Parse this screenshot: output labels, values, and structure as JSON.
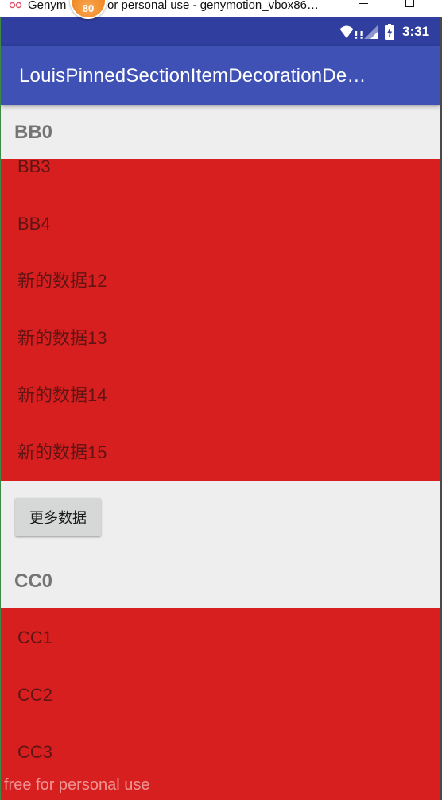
{
  "window": {
    "title_visible_start": "Genym",
    "title_visible_end": "or personal use - genymotion_vbox86…",
    "app_icon": "genymotion-icon",
    "minimize_icon": "minimize-icon",
    "maximize_icon": "maximize-icon",
    "notification_badge": "80"
  },
  "status_bar": {
    "icons": [
      "wifi-alert-icon",
      "signal-alert-icon",
      "battery-charging-icon"
    ],
    "time": "3:31"
  },
  "app_bar": {
    "title": "LouisPinnedSectionItemDecorationDe…"
  },
  "list": {
    "sections": [
      {
        "header": "BB0",
        "items": [
          "BB3",
          "BB4",
          "新的数据12",
          "新的数据13",
          "新的数据14",
          "新的数据15"
        ],
        "footer_button": "更多数据"
      },
      {
        "header": "CC0",
        "items": [
          "CC1",
          "CC2",
          "CC3"
        ]
      }
    ]
  },
  "watermark": "free for personal use",
  "colors": {
    "primary": "#3F51B5",
    "primary_dark": "#303F9F",
    "item_bg": "#D71F1F",
    "list_bg": "#EEEEEE",
    "badge": "#F08A24",
    "header_text": "#757575",
    "item_text": "#611414"
  }
}
